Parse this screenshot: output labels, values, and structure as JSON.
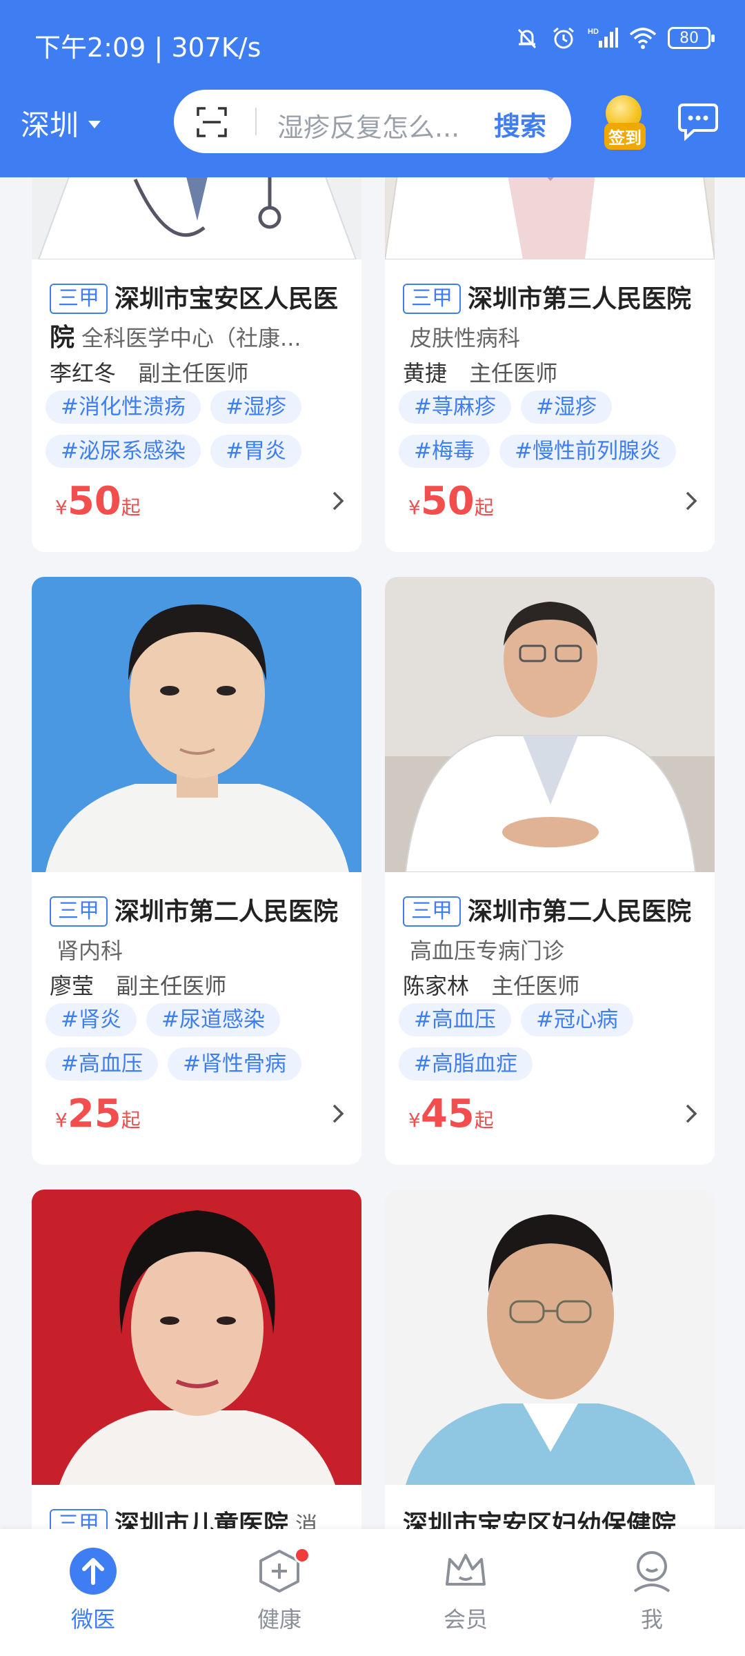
{
  "status": {
    "time": "下午2:09",
    "speed": "307K/s",
    "battery": "80"
  },
  "header": {
    "city": "深圳",
    "search_placeholder": "湿疹反复怎么...",
    "search_button": "搜索",
    "checkin_label": "签到"
  },
  "cards": [
    {
      "grade": "三甲",
      "hospital": "深圳市宝安区人民医院",
      "dept": "全科医学中心（社康...",
      "doctor": "李红冬",
      "rank": "副主任医师",
      "tags": [
        "#消化性溃疡",
        "#湿疹",
        "#泌尿系感染",
        "#胃炎"
      ],
      "currency": "¥",
      "price": "50",
      "price_suffix": "起"
    },
    {
      "grade": "三甲",
      "hospital": "深圳市第三人民医院",
      "dept": "皮肤性病科",
      "doctor": "黄捷",
      "rank": "主任医师",
      "tags": [
        "#荨麻疹",
        "#湿疹",
        "#梅毒",
        "#慢性前列腺炎"
      ],
      "currency": "¥",
      "price": "50",
      "price_suffix": "起"
    },
    {
      "grade": "三甲",
      "hospital": "深圳市第二人民医院",
      "dept": "肾内科",
      "doctor": "廖莹",
      "rank": "副主任医师",
      "tags": [
        "#肾炎",
        "#尿道感染",
        "#高血压",
        "#肾性骨病"
      ],
      "currency": "¥",
      "price": "25",
      "price_suffix": "起"
    },
    {
      "grade": "三甲",
      "hospital": "深圳市第二人民医院",
      "dept": "高血压专病门诊",
      "doctor": "陈家林",
      "rank": "主任医师",
      "tags": [
        "#高血压",
        "#冠心病",
        "#高脂血症"
      ],
      "currency": "¥",
      "price": "45",
      "price_suffix": "起"
    },
    {
      "grade": "三甲",
      "hospital": "深圳市儿童医院",
      "dept": "消"
    },
    {
      "hospital": "深圳市宝安区妇幼保健院"
    }
  ],
  "nav": [
    {
      "label": "微医"
    },
    {
      "label": "健康"
    },
    {
      "label": "会员"
    },
    {
      "label": "我"
    }
  ],
  "colors": {
    "primary": "#3f7ef2",
    "price": "#f24e4e",
    "tag_bg": "#edf3fe"
  }
}
